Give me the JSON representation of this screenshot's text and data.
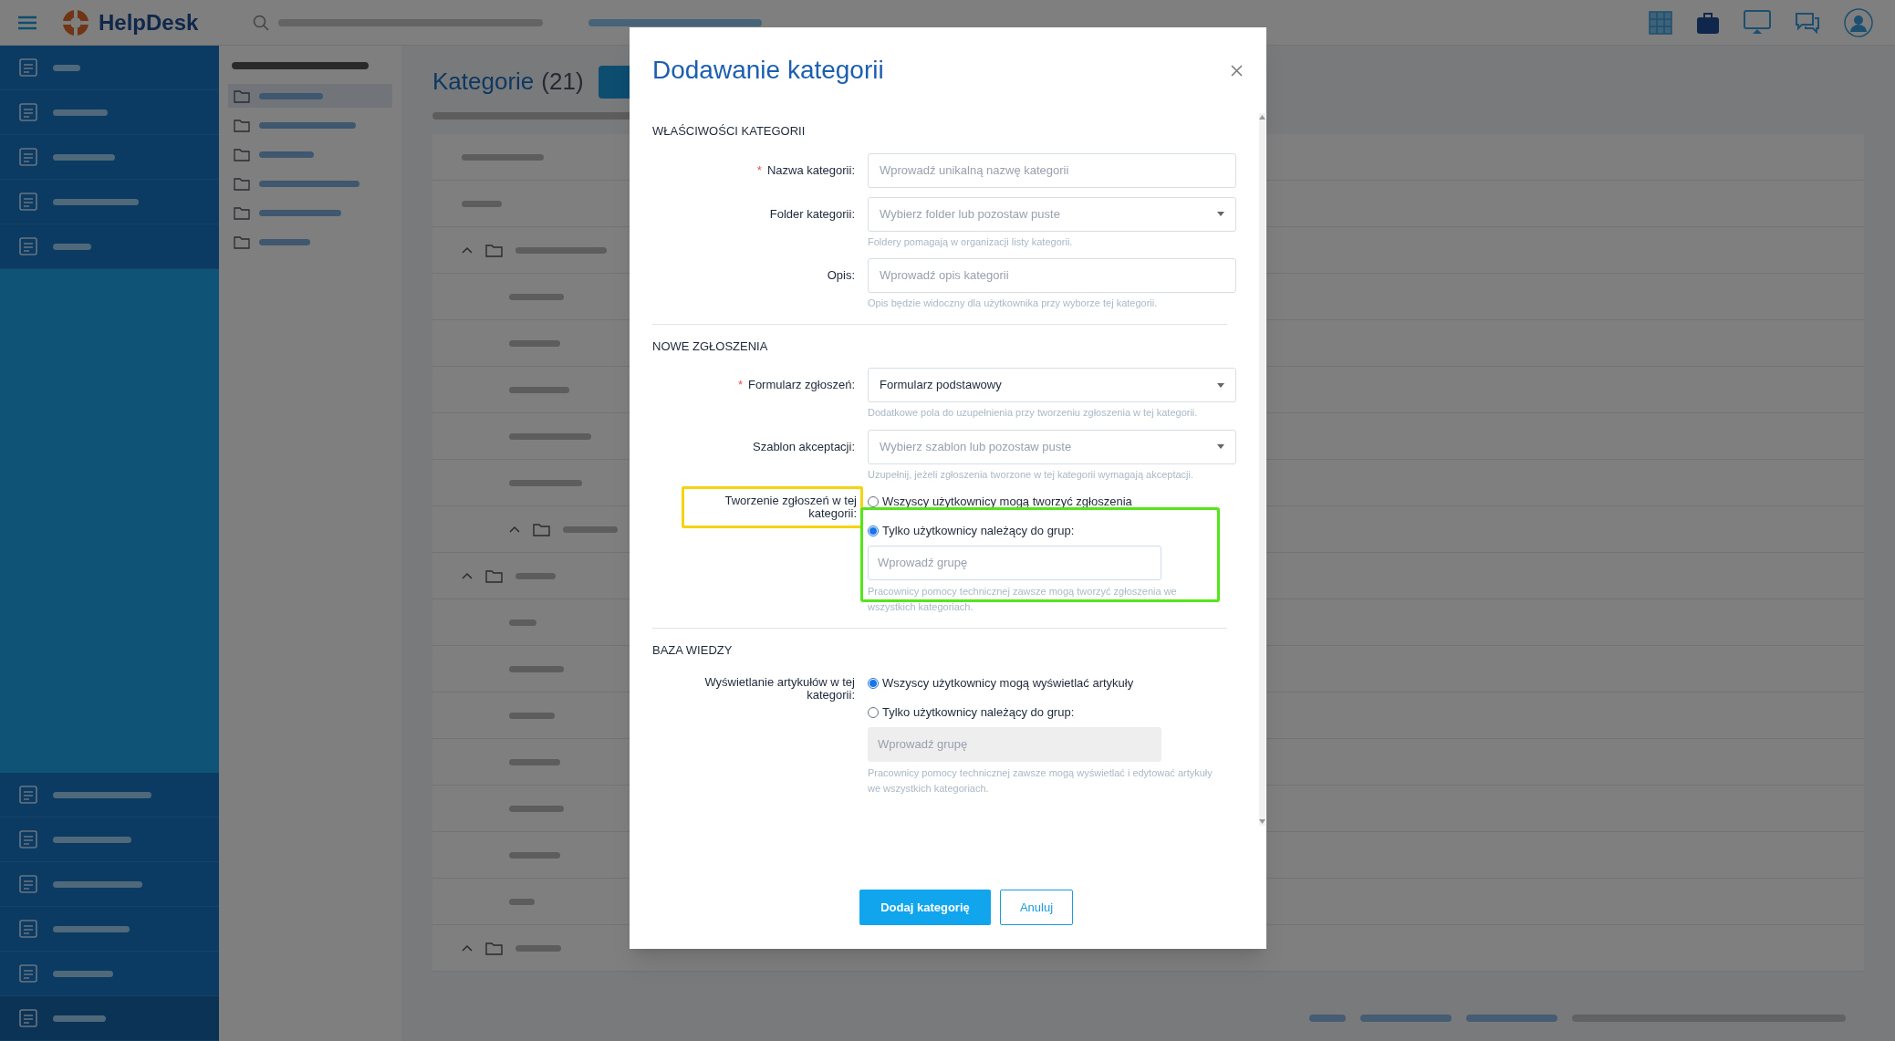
{
  "top_bar": {
    "app_name": "HelpDesk"
  },
  "nav": {
    "top_items": [
      {
        "selected": false
      },
      {
        "selected": false
      },
      {
        "selected": false
      },
      {
        "selected": false
      },
      {
        "selected": false
      }
    ],
    "bottom_items": [
      {
        "selected": false
      },
      {
        "selected": false
      },
      {
        "selected": false
      },
      {
        "selected": false
      },
      {
        "selected": false
      },
      {
        "selected": true
      }
    ]
  },
  "settings_menu": {
    "items": [
      {
        "selected": true
      },
      {
        "selected": false
      },
      {
        "selected": false
      },
      {
        "selected": false
      },
      {
        "selected": false
      },
      {
        "selected": false
      }
    ]
  },
  "page": {
    "title": "Kategorie",
    "count": "(21)"
  },
  "modal": {
    "title": "Dodawanie kategorii",
    "sections": [
      {
        "heading": "WŁAŚCIWOŚCI KATEGORII",
        "fields": [
          {
            "kind": "text",
            "label": "Nazwa kategorii:",
            "required_mark": "*",
            "placeholder": "Wprowadź unikalną nazwę kategorii"
          },
          {
            "kind": "select",
            "label": "Folder kategorii:",
            "placeholder": "Wybierz folder lub pozostaw puste",
            "help": "Foldery pomagają w organizacji listy kategorii."
          },
          {
            "kind": "text",
            "label": "Opis:",
            "placeholder": "Wprowadź opis kategorii",
            "help": "Opis będzie widoczny dla użytkownika przy wyborze tej kategorii."
          }
        ]
      },
      {
        "heading": "NOWE ZGŁOSZENIA",
        "fields": [
          {
            "kind": "select",
            "label": "Formularz zgłoszeń:",
            "required_mark": "*",
            "value": "Formularz podstawowy",
            "help": "Dodatkowe pola do uzupełnienia przy tworzeniu zgłoszenia w tej kategorii."
          },
          {
            "kind": "select",
            "label": "Szablon akceptacji:",
            "placeholder": "Wybierz szablon lub pozostaw puste",
            "help": "Uzupełnij, jeżeli zgłoszenia tworzone w tej kategorii wymagają akceptacji."
          },
          {
            "kind": "radio",
            "label": "Tworzenie zgłoszeń w tej kategorii:",
            "label_highlighted": true,
            "group_highlighted": true,
            "options": [
              {
                "label": "Wszyscy użytkownicy mogą tworzyć zgłoszenia",
                "selected": false
              },
              {
                "label": "Tylko użytkownicy należący do grup:",
                "selected": true
              }
            ],
            "group_field": {
              "placeholder": "Wprowadź grupę",
              "disabled": false
            },
            "help": "Pracownicy pomocy technicznej zawsze mogą tworzyć zgłoszenia we wszystkich kategoriach."
          }
        ]
      },
      {
        "heading": "BAZA WIEDZY",
        "fields": [
          {
            "kind": "radio",
            "label": "Wyświetlanie artykułów w tej kategorii:",
            "label_highlighted": false,
            "group_highlighted": false,
            "options": [
              {
                "label": "Wszyscy użytkownicy mogą wyświetlać artykuły",
                "selected": true
              },
              {
                "label": "Tylko użytkownicy należący do grup:",
                "selected": false
              }
            ],
            "group_field": {
              "placeholder": "Wprowadź grupę",
              "disabled": true
            },
            "help": "Pracownicy pomocy technicznej zawsze mogą wyświetlać i edytować artykuły we wszystkich kategoriach."
          }
        ]
      }
    ],
    "buttons": [
      {
        "kind": "primary",
        "label": "Dodaj kategorię"
      },
      {
        "kind": "secondary",
        "label": "Anuluj"
      }
    ]
  }
}
